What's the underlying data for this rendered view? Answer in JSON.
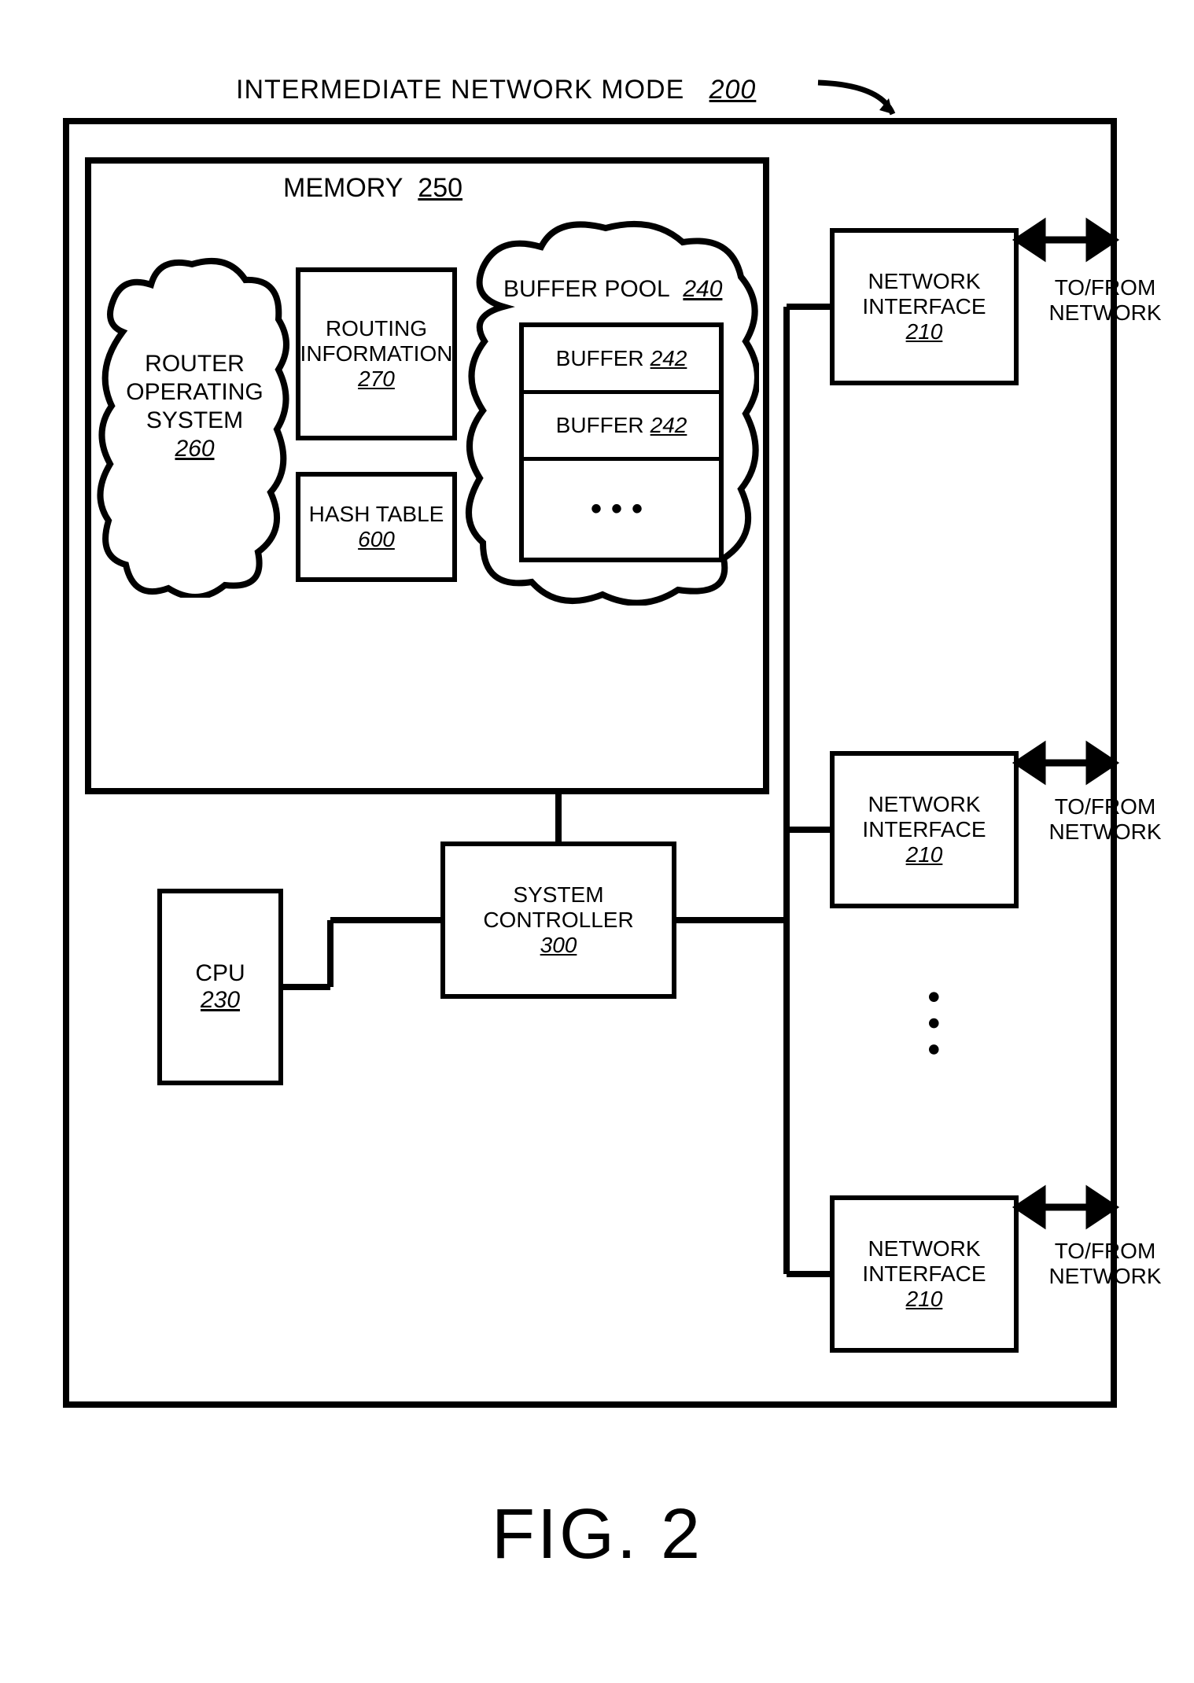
{
  "title": {
    "text": "INTERMEDIATE NETWORK MODE",
    "num": "200"
  },
  "memory": {
    "label": "MEMORY",
    "num": "250"
  },
  "os_cloud": {
    "line1": "ROUTER",
    "line2": "OPERATING",
    "line3": "SYSTEM",
    "num": "260"
  },
  "routing": {
    "line1": "ROUTING",
    "line2": "INFORMATION",
    "num": "270"
  },
  "hash": {
    "label": "HASH TABLE",
    "num": "600"
  },
  "buffer_pool": {
    "label": "BUFFER POOL",
    "num": "240",
    "rows": [
      {
        "label": "BUFFER",
        "num": "242"
      },
      {
        "label": "BUFFER",
        "num": "242"
      }
    ]
  },
  "cpu": {
    "label": "CPU",
    "num": "230"
  },
  "sysctrl": {
    "line1": "SYSTEM",
    "line2": "CONTROLLER",
    "num": "300"
  },
  "nif": {
    "line1": "NETWORK",
    "line2": "INTERFACE",
    "num": "210"
  },
  "tofrom": {
    "line1": "TO/FROM",
    "line2": "NETWORK"
  },
  "figure": "FIG. 2"
}
